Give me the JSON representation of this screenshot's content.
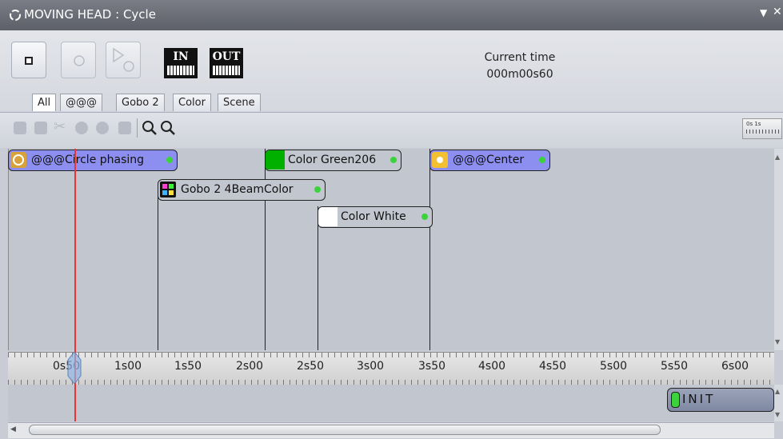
{
  "window": {
    "title": "MOVING HEAD : Cycle",
    "title_icon": "cycle-icon",
    "controls": {
      "dropdown_glyph": "▼",
      "close_glyph": "✕"
    }
  },
  "transport": {
    "stop_icon": "stop-icon",
    "record_icon": "record-icon",
    "play_record_icon": "play-record-icon",
    "in_label": "IN",
    "out_label": "OUT"
  },
  "current_time": {
    "label": "Current time",
    "value": "000m00s60"
  },
  "tabs": [
    {
      "label": "All",
      "active": true
    },
    {
      "label": "@@@",
      "active": false
    },
    {
      "label": "Gobo 2",
      "active": false
    },
    {
      "label": "Color",
      "active": false
    },
    {
      "label": "Scene",
      "active": false
    }
  ],
  "edit_toolbar": {
    "icons": [
      "copy-icon",
      "paste-icon",
      "cut-icon",
      "delete-icon",
      "clear-icon",
      "save-icon",
      "zoom-in-icon",
      "zoom-out-icon"
    ],
    "zoom_widget": "0s 1s"
  },
  "clips": [
    {
      "label": "@@@Circle phasing",
      "icon": "circle-phasing-icon",
      "fill": "#8c8ef0"
    },
    {
      "label": "Gobo 2 4BeamColor",
      "icon": "gobo-icon",
      "fill": "#c2c6cf"
    },
    {
      "label": "Color Green206",
      "icon": "color-swatch-icon",
      "swatch": "#00b000",
      "fill": "#c2c6cf"
    },
    {
      "label": "Color White",
      "icon": "color-swatch-icon",
      "swatch": "#ffffff",
      "fill": "#c2c6cf"
    },
    {
      "label": "@@@Center",
      "icon": "center-icon",
      "fill": "#8c8ef0"
    }
  ],
  "ruler": {
    "labels": [
      "0s50",
      "1s00",
      "1s50",
      "2s00",
      "2s50",
      "3s00",
      "3s50",
      "4s00",
      "4s50",
      "5s00",
      "5s50",
      "6s00"
    ]
  },
  "lane2": {
    "init_label": "INIT"
  },
  "colors": {
    "cursor": "#e33333",
    "clip_active_dot": "#3cd23c",
    "purple_clip": "#8c8ef0"
  }
}
